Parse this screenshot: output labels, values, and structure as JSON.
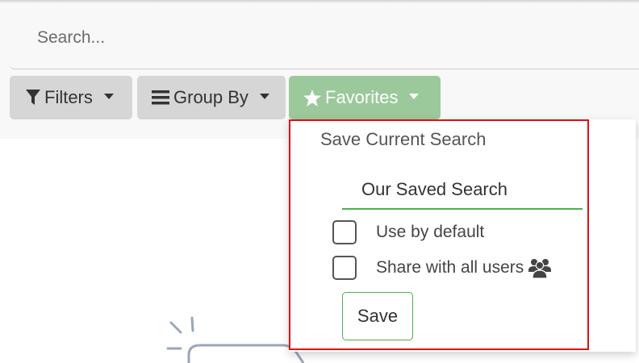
{
  "search": {
    "placeholder": "Search..."
  },
  "toolbar": {
    "filters_label": "Filters",
    "groupby_label": "Group By",
    "favorites_label": "Favorites",
    "favorites_color": "#9bc99b"
  },
  "favorites_dropdown": {
    "title": "Save Current Search",
    "name_value": "Our Saved Search",
    "use_by_default_label": "Use by default",
    "use_by_default_checked": false,
    "share_label": "Share with all users",
    "share_checked": false,
    "save_label": "Save",
    "accent_color": "#4caf50",
    "highlight_color": "#e01010"
  },
  "icons": {
    "filters": "filter-icon",
    "groupby": "list-icon",
    "favorites": "star-icon",
    "share": "users-icon"
  }
}
